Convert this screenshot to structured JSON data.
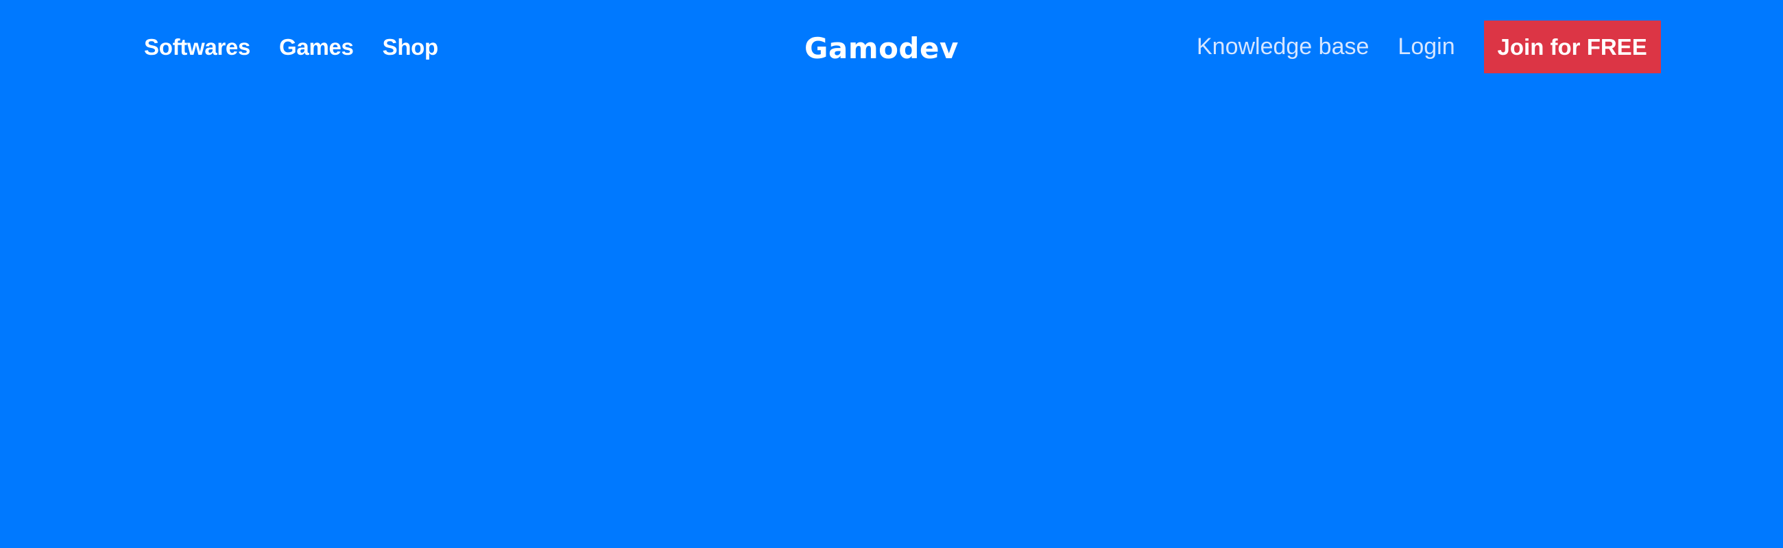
{
  "colors": {
    "background": "#0079FF",
    "cta_background": "#DC3545",
    "nav_text": "#FFFFFF",
    "nav_text_light": "#D6E6FF"
  },
  "navbar": {
    "left_links": [
      "Softwares",
      "Games",
      "Shop"
    ],
    "logo": "Gamodev",
    "right_links": {
      "knowledge_base": "Knowledge base",
      "login": "Login"
    },
    "cta": "Join for FREE"
  }
}
